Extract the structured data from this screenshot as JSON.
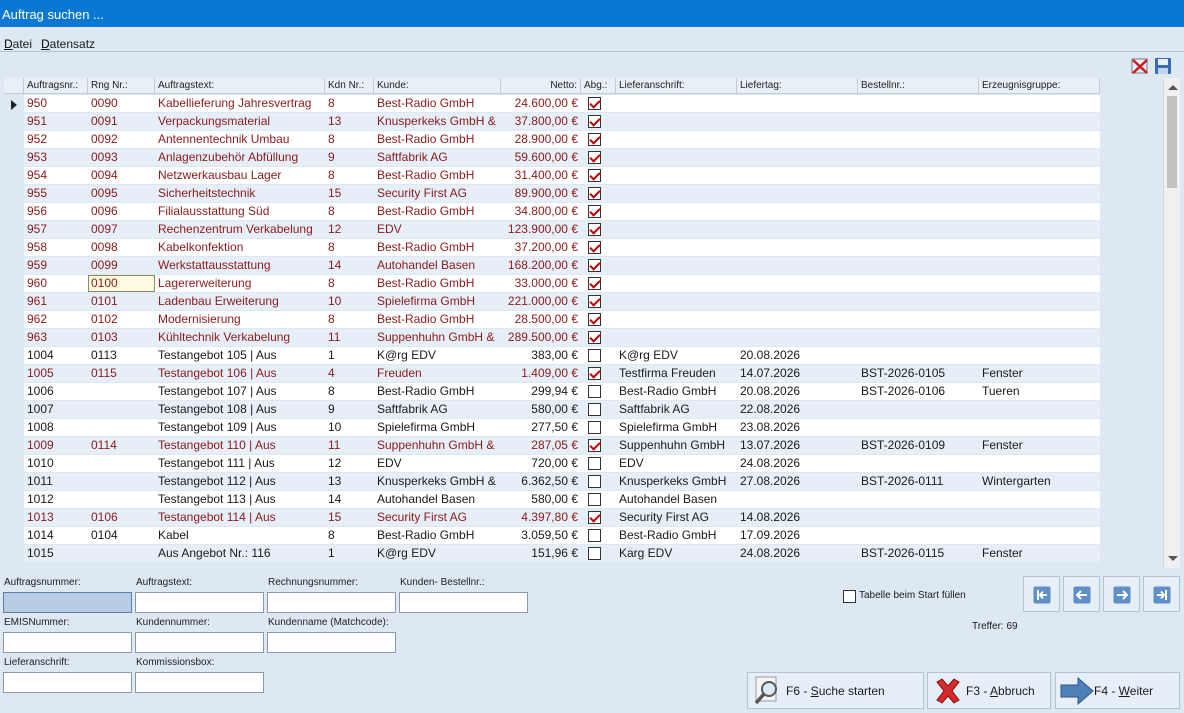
{
  "window": {
    "title": "Auftrag suchen ..."
  },
  "menu": {
    "items": [
      {
        "label": "Datei"
      },
      {
        "label": "Datensatz"
      }
    ]
  },
  "table": {
    "columns": [
      "Auftragsnr.:",
      "Rng Nr.:",
      "Auftragstext:",
      "Kdn Nr.:",
      "Kunde:",
      "Netto:",
      "Abg.:",
      "Lieferanschrift:",
      "Liefertag:",
      "Bestellnr.:",
      "Erzeugnisgruppe:"
    ],
    "rows": [
      {
        "auftragsnr": "950",
        "rngnr": "0090",
        "text": "Kabellieferung Jahresvertrag",
        "kdnnr": "8",
        "kunde": "Best-Radio GmbH",
        "netto": "24.600,00 €",
        "abg": true,
        "liefer": "",
        "liefertag": "",
        "bestell": "",
        "gruppe": ""
      },
      {
        "auftragsnr": "951",
        "rngnr": "0091",
        "text": "Verpackungsmaterial",
        "kdnnr": "13",
        "kunde": "Knusperkeks GmbH &",
        "netto": "37.800,00 €",
        "abg": true,
        "liefer": "",
        "liefertag": "",
        "bestell": "",
        "gruppe": ""
      },
      {
        "auftragsnr": "952",
        "rngnr": "0092",
        "text": "Antennentechnik Umbau",
        "kdnnr": "8",
        "kunde": "Best-Radio GmbH",
        "netto": "28.900,00 €",
        "abg": true,
        "liefer": "",
        "liefertag": "",
        "bestell": "",
        "gruppe": ""
      },
      {
        "auftragsnr": "953",
        "rngnr": "0093",
        "text": "Anlagenzubehör Abfüllung",
        "kdnnr": "9",
        "kunde": "Saftfabrik AG",
        "netto": "59.600,00 €",
        "abg": true,
        "liefer": "",
        "liefertag": "",
        "bestell": "",
        "gruppe": ""
      },
      {
        "auftragsnr": "954",
        "rngnr": "0094",
        "text": "Netzwerkausbau Lager",
        "kdnnr": "8",
        "kunde": "Best-Radio GmbH",
        "netto": "31.400,00 €",
        "abg": true,
        "liefer": "",
        "liefertag": "",
        "bestell": "",
        "gruppe": ""
      },
      {
        "auftragsnr": "955",
        "rngnr": "0095",
        "text": "Sicherheitstechnik",
        "kdnnr": "15",
        "kunde": "Security First AG",
        "netto": "89.900,00 €",
        "abg": true,
        "liefer": "",
        "liefertag": "",
        "bestell": "",
        "gruppe": ""
      },
      {
        "auftragsnr": "956",
        "rngnr": "0096",
        "text": "Filialausstattung Süd",
        "kdnnr": "8",
        "kunde": "Best-Radio GmbH",
        "netto": "34.800,00 €",
        "abg": true,
        "liefer": "",
        "liefertag": "",
        "bestell": "",
        "gruppe": ""
      },
      {
        "auftragsnr": "957",
        "rngnr": "0097",
        "text": "Rechenzentrum Verkabelung",
        "kdnnr": "12",
        "kunde": "EDV",
        "netto": "123.900,00 €",
        "abg": true,
        "liefer": "",
        "liefertag": "",
        "bestell": "",
        "gruppe": ""
      },
      {
        "auftragsnr": "958",
        "rngnr": "0098",
        "text": "Kabelkonfektion",
        "kdnnr": "8",
        "kunde": "Best-Radio GmbH",
        "netto": "37.200,00 €",
        "abg": true,
        "liefer": "",
        "liefertag": "",
        "bestell": "",
        "gruppe": ""
      },
      {
        "auftragsnr": "959",
        "rngnr": "0099",
        "text": "Werkstattausstattung",
        "kdnnr": "14",
        "kunde": "Autohandel Basen",
        "netto": "168.200,00 €",
        "abg": true,
        "liefer": "",
        "liefertag": "",
        "bestell": "",
        "gruppe": ""
      },
      {
        "auftragsnr": "960",
        "rngnr": "0100",
        "text": "Lagererweiterung",
        "kdnnr": "8",
        "kunde": "Best-Radio GmbH",
        "netto": "33.000,00 €",
        "abg": true,
        "liefer": "",
        "liefertag": "",
        "bestell": "",
        "gruppe": ""
      },
      {
        "auftragsnr": "961",
        "rngnr": "0101",
        "text": "Ladenbau Erweiterung",
        "kdnnr": "10",
        "kunde": "Spielefirma GmbH",
        "netto": "221.000,00 €",
        "abg": true,
        "liefer": "",
        "liefertag": "",
        "bestell": "",
        "gruppe": ""
      },
      {
        "auftragsnr": "962",
        "rngnr": "0102",
        "text": "Modernisierung",
        "kdnnr": "8",
        "kunde": "Best-Radio GmbH",
        "netto": "28.500,00 €",
        "abg": true,
        "liefer": "",
        "liefertag": "",
        "bestell": "",
        "gruppe": ""
      },
      {
        "auftragsnr": "963",
        "rngnr": "0103",
        "text": "Kühltechnik Verkabelung",
        "kdnnr": "11",
        "kunde": "Suppenhuhn GmbH &",
        "netto": "289.500,00 €",
        "abg": true,
        "liefer": "",
        "liefertag": "",
        "bestell": "",
        "gruppe": ""
      },
      {
        "auftragsnr": "1004",
        "rngnr": "0113",
        "text": "Testangebot 105 | Aus",
        "kdnnr": "1",
        "kunde": "K@rg EDV",
        "netto": "383,00 €",
        "abg": false,
        "liefer": "K@rg EDV",
        "liefertag": "20.08.2026",
        "bestell": "",
        "gruppe": ""
      },
      {
        "auftragsnr": "1005",
        "rngnr": "0115",
        "text": "Testangebot 106 | Aus",
        "kdnnr": "4",
        "kunde": "Freuden",
        "netto": "1.409,00 €",
        "abg": true,
        "liefer": "Testfirma Freuden",
        "liefertag": "14.07.2026",
        "bestell": "BST-2026-0105",
        "gruppe": "Fenster"
      },
      {
        "auftragsnr": "1006",
        "rngnr": "",
        "text": "Testangebot 107 | Aus",
        "kdnnr": "8",
        "kunde": "Best-Radio GmbH",
        "netto": "299,94 €",
        "abg": false,
        "liefer": "Best-Radio GmbH",
        "liefertag": "20.08.2026",
        "bestell": "BST-2026-0106",
        "gruppe": "Tueren"
      },
      {
        "auftragsnr": "1007",
        "rngnr": "",
        "text": "Testangebot 108 | Aus",
        "kdnnr": "9",
        "kunde": "Saftfabrik AG",
        "netto": "580,00 €",
        "abg": false,
        "liefer": "Saftfabrik AG",
        "liefertag": "22.08.2026",
        "bestell": "",
        "gruppe": ""
      },
      {
        "auftragsnr": "1008",
        "rngnr": "",
        "text": "Testangebot 109 | Aus",
        "kdnnr": "10",
        "kunde": "Spielefirma GmbH",
        "netto": "277,50 €",
        "abg": false,
        "liefer": "Spielefirma GmbH",
        "liefertag": "23.08.2026",
        "bestell": "",
        "gruppe": ""
      },
      {
        "auftragsnr": "1009",
        "rngnr": "0114",
        "text": "Testangebot 110 | Aus",
        "kdnnr": "11",
        "kunde": "Suppenhuhn GmbH &",
        "netto": "287,05 €",
        "abg": true,
        "liefer": "Suppenhuhn GmbH",
        "liefertag": "13.07.2026",
        "bestell": "BST-2026-0109",
        "gruppe": "Fenster"
      },
      {
        "auftragsnr": "1010",
        "rngnr": "",
        "text": "Testangebot 111 | Aus",
        "kdnnr": "12",
        "kunde": "EDV",
        "netto": "720,00 €",
        "abg": false,
        "liefer": "EDV",
        "liefertag": "24.08.2026",
        "bestell": "",
        "gruppe": ""
      },
      {
        "auftragsnr": "1011",
        "rngnr": "",
        "text": "Testangebot 112 | Aus",
        "kdnnr": "13",
        "kunde": "Knusperkeks GmbH &",
        "netto": "6.362,50 €",
        "abg": false,
        "liefer": "Knusperkeks GmbH",
        "liefertag": "27.08.2026",
        "bestell": "BST-2026-0111",
        "gruppe": "Wintergarten"
      },
      {
        "auftragsnr": "1012",
        "rngnr": "",
        "text": "Testangebot 113 | Aus",
        "kdnnr": "14",
        "kunde": "Autohandel Basen",
        "netto": "580,00 €",
        "abg": false,
        "liefer": "Autohandel Basen",
        "liefertag": "",
        "bestell": "",
        "gruppe": ""
      },
      {
        "auftragsnr": "1013",
        "rngnr": "0106",
        "text": "Testangebot 114 | Aus",
        "kdnnr": "15",
        "kunde": "Security First AG",
        "netto": "4.397,80 €",
        "abg": true,
        "liefer": "Security First AG",
        "liefertag": "14.08.2026",
        "bestell": "",
        "gruppe": ""
      },
      {
        "auftragsnr": "1014",
        "rngnr": "0104",
        "text": "Kabel",
        "kdnnr": "8",
        "kunde": "Best-Radio GmbH",
        "netto": "3.059,50 €",
        "abg": false,
        "liefer": "Best-Radio GmbH",
        "liefertag": "17.09.2026",
        "bestell": "",
        "gruppe": ""
      },
      {
        "auftragsnr": "1015",
        "rngnr": "",
        "text": "Aus Angebot Nr.: 116",
        "kdnnr": "1",
        "kunde": "K@rg EDV",
        "netto": "151,96 €",
        "abg": false,
        "liefer": "Karg EDV",
        "liefertag": "24.08.2026",
        "bestell": "BST-2026-0115",
        "gruppe": "Fenster"
      }
    ]
  },
  "form": {
    "auftragsnummer_label": "Auftragsnummer:",
    "auftragstext_label": "Auftragstext:",
    "rechnungsnummer_label": "Rechnungsnummer:",
    "kunden_bestellnr_label": "Kunden- Bestellnr.:",
    "emisnummer_label": "EMISNummer:",
    "kundennummer_label": "Kundennummer:",
    "kundenname_label": "Kundenname (Matchcode):",
    "lieferanschrift_label": "Lieferanschrift:",
    "kommissionsbox_label": "Kommissionsbox:"
  },
  "options": {
    "fill_on_start_label": "Tabelle beim Start füllen"
  },
  "status": {
    "treffer": "Treffer: 69"
  },
  "buttons": {
    "search": {
      "key": "F6 - ",
      "label": "Suche starten"
    },
    "cancel": {
      "key": "F3 - ",
      "label": "Abbruch"
    },
    "next": {
      "key": "F4 - ",
      "label": "Weiter"
    }
  },
  "colors": {
    "closed_row": "#8b1a1a",
    "open_row": "#1a1a1a",
    "titlebar": "#0a78d2"
  },
  "icons": {
    "navigation": [
      "first-record-icon",
      "previous-record-icon",
      "next-record-icon",
      "last-record-icon"
    ]
  }
}
